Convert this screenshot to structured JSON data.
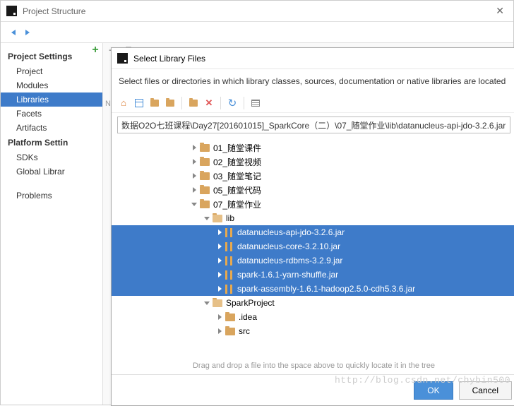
{
  "parent": {
    "title": "Project Structure",
    "sidebar": {
      "groups": [
        {
          "heading": "Project Settings",
          "items": [
            "Project",
            "Modules",
            "Libraries",
            "Facets",
            "Artifacts"
          ],
          "selected": "Libraries"
        },
        {
          "heading": "Platform Settings",
          "items": [
            "SDKs",
            "Global Libraries"
          ]
        },
        {
          "heading": "",
          "items": [
            "Problems"
          ]
        }
      ]
    },
    "n_label": "N"
  },
  "modal": {
    "title": "Select Library Files",
    "instruction": "Select files or directories in which library classes, sources, documentation or native libraries are located",
    "path": "数据O2O七班课程\\Day27[201601015]_SparkCore（二）\\07_随堂作业\\lib\\datanucleus-api-jdo-3.2.6.jar",
    "tree": [
      {
        "indent": 4,
        "chev": "right",
        "type": "folder",
        "label": "01_随堂课件",
        "sel": false
      },
      {
        "indent": 4,
        "chev": "right",
        "type": "folder",
        "label": "02_随堂视频",
        "sel": false
      },
      {
        "indent": 4,
        "chev": "right",
        "type": "folder",
        "label": "03_随堂笔记",
        "sel": false
      },
      {
        "indent": 4,
        "chev": "right",
        "type": "folder",
        "label": "05_随堂代码",
        "sel": false
      },
      {
        "indent": 4,
        "chev": "down",
        "type": "folder",
        "label": "07_随堂作业",
        "sel": false
      },
      {
        "indent": 5,
        "chev": "down",
        "type": "folder-open",
        "label": "lib",
        "sel": false
      },
      {
        "indent": 6,
        "chev": "right",
        "type": "jar",
        "label": "datanucleus-api-jdo-3.2.6.jar",
        "sel": true
      },
      {
        "indent": 6,
        "chev": "right",
        "type": "jar",
        "label": "datanucleus-core-3.2.10.jar",
        "sel": true
      },
      {
        "indent": 6,
        "chev": "right",
        "type": "jar",
        "label": "datanucleus-rdbms-3.2.9.jar",
        "sel": true
      },
      {
        "indent": 6,
        "chev": "right",
        "type": "jar",
        "label": "spark-1.6.1-yarn-shuffle.jar",
        "sel": true
      },
      {
        "indent": 6,
        "chev": "right",
        "type": "jar",
        "label": "spark-assembly-1.6.1-hadoop2.5.0-cdh5.3.6.jar",
        "sel": true
      },
      {
        "indent": 5,
        "chev": "down",
        "type": "folder-open",
        "label": "SparkProject",
        "sel": false
      },
      {
        "indent": 6,
        "chev": "right",
        "type": "folder",
        "label": ".idea",
        "sel": false
      },
      {
        "indent": 6,
        "chev": "right",
        "type": "folder",
        "label": "src",
        "sel": false
      }
    ],
    "dropHint": "Drag and drop a file into the space above to quickly locate it in the tree",
    "okLabel": "OK",
    "cancelLabel": "Cancel"
  },
  "watermark": "http://blog.csdn.net/chybin500"
}
